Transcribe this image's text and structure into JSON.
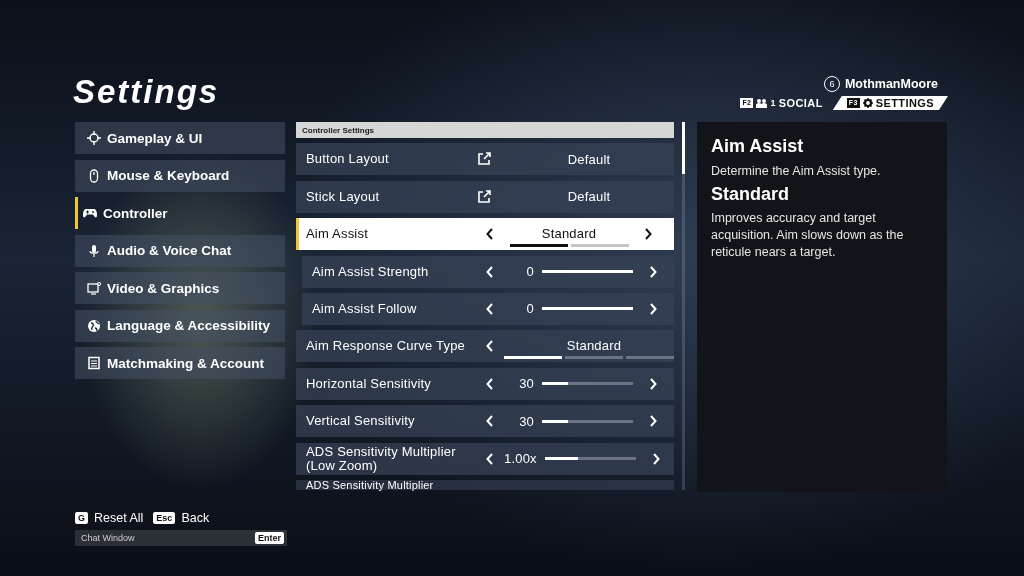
{
  "title": "Settings",
  "profile": {
    "level": "6",
    "name": "MothmanMoore"
  },
  "top_tabs": [
    {
      "key": "F2",
      "count": "1",
      "label": "SOCIAL",
      "selected": false
    },
    {
      "key": "F3",
      "label": "SETTINGS",
      "selected": true
    }
  ],
  "sidebar": {
    "items": [
      {
        "label": "Gameplay & UI",
        "selected": false
      },
      {
        "label": "Mouse & Keyboard",
        "selected": false
      },
      {
        "label": "Controller",
        "selected": true
      },
      {
        "label": "Audio & Voice Chat",
        "selected": false
      },
      {
        "label": "Video & Graphics",
        "selected": false
      },
      {
        "label": "Language & Accessibility",
        "selected": false
      },
      {
        "label": "Matchmaking & Account",
        "selected": false
      }
    ]
  },
  "section_header": "Controller Settings",
  "settings": [
    {
      "kind": "link",
      "label": "Button Layout",
      "value": "Default",
      "selected": false,
      "indented": false
    },
    {
      "kind": "link",
      "label": "Stick Layout",
      "value": "Default",
      "selected": false,
      "indented": false
    },
    {
      "kind": "choice",
      "label": "Aim Assist",
      "value": "Standard",
      "selected": true,
      "indented": false,
      "segments": [
        {
          "selected": true
        },
        {
          "selected": false
        }
      ]
    },
    {
      "kind": "slider",
      "label": "Aim Assist Strength",
      "reading": "0",
      "level": 1,
      "selected": false,
      "indented": true
    },
    {
      "kind": "slider",
      "label": "Aim Assist Follow",
      "reading": "0",
      "level": 1,
      "selected": false,
      "indented": true
    },
    {
      "kind": "choice",
      "label": "Aim Response Curve Type",
      "value": "Standard",
      "selected": false,
      "indented": false,
      "segments": [
        {
          "selected": true
        },
        {
          "selected": false
        },
        {
          "selected": false
        }
      ]
    },
    {
      "kind": "slider",
      "label": "Horizontal Sensitivity",
      "reading": "30",
      "level": 0.29,
      "selected": false,
      "indented": false
    },
    {
      "kind": "slider",
      "label": "Vertical Sensitivity",
      "reading": "30",
      "level": 0.29,
      "selected": false,
      "indented": false
    },
    {
      "kind": "slider",
      "label": "ADS Sensitivity Multiplier (Low Zoom)",
      "reading": "1.00x",
      "level": 0.37,
      "selected": false,
      "indented": false
    },
    {
      "kind": "partial",
      "label": "ADS Sensitivity Multiplier",
      "selected": false,
      "indented": false
    }
  ],
  "description": {
    "title": "Aim Assist",
    "text": "Determine the Aim Assist type.",
    "option_title": "Standard",
    "option_text": "Improves accuracy and target acquisition. Aim slows down as the reticule nears a target."
  },
  "footer": {
    "actions": [
      {
        "key": "G",
        "label": "Reset All"
      },
      {
        "key": "Esc",
        "label": "Back"
      }
    ],
    "chat": {
      "placeholder": "Chat Window",
      "key": "Enter"
    }
  }
}
